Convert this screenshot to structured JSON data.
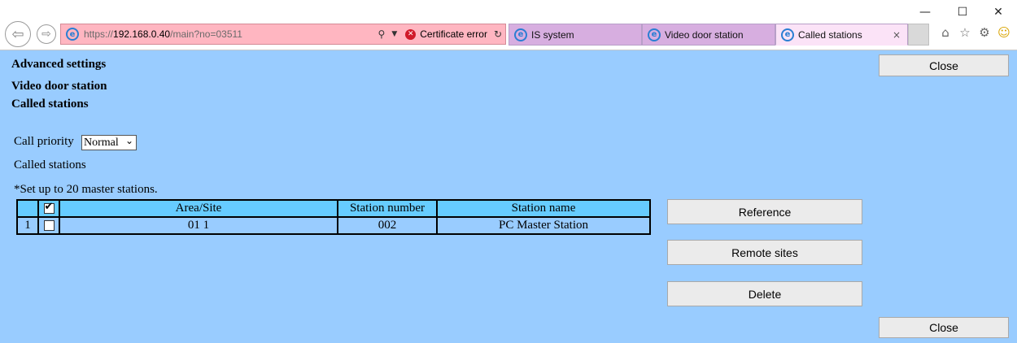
{
  "browser": {
    "address": {
      "prefix": "https://",
      "host": "192.168.0.40",
      "path": "/main?no=03511",
      "cert_error": "Certificate error"
    },
    "tabs": [
      {
        "label": "IS system",
        "active": false
      },
      {
        "label": "Video door station",
        "active": false
      },
      {
        "label": "Called stations",
        "active": true
      }
    ],
    "tab_close": "×",
    "window": {
      "minimize": "—",
      "maximize": "☐",
      "close": "✕"
    }
  },
  "page": {
    "headings": [
      "Advanced settings",
      "Video door station",
      "Called stations"
    ],
    "call_priority": {
      "label": "Call priority",
      "value": "Normal"
    },
    "section_label": "Called stations",
    "note": "*Set up to 20 master stations.",
    "table": {
      "headers": [
        "Area/Site",
        "Station number",
        "Station name"
      ],
      "rows": [
        {
          "index": "1",
          "checked": false,
          "area_site": "01 1",
          "station_number": "002",
          "station_name": "PC Master Station"
        }
      ]
    },
    "buttons": {
      "close_top": "Close",
      "reference": "Reference",
      "remote_sites": "Remote sites",
      "delete": "Delete",
      "close_bottom": "Close"
    }
  },
  "colors": {
    "page_bg": "#99ccff",
    "table_header_bg": "#66ccff",
    "address_bar_bg": "#ffb6c1",
    "tab_bg": "#d7aee0",
    "active_tab_bg": "#fbe3f7"
  }
}
